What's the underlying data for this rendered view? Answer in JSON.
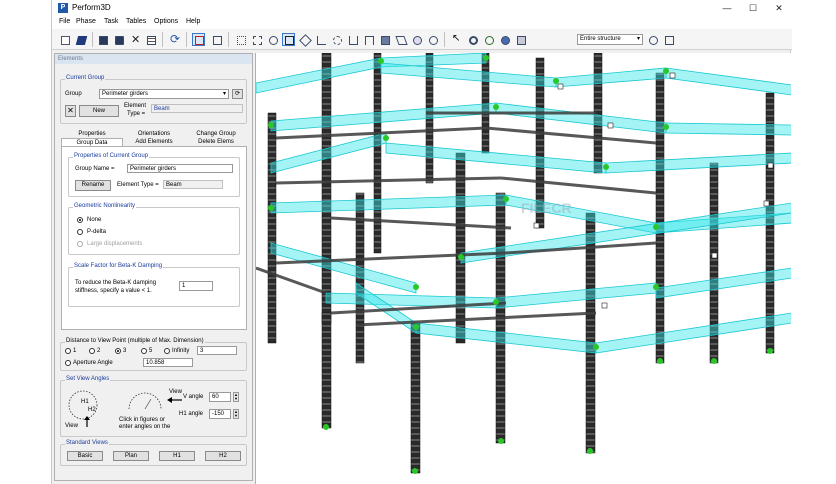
{
  "app": {
    "title": "Perform3D",
    "logo_letter": "P"
  },
  "window_controls": {
    "minimize": "—",
    "maximize": "☐",
    "close": "✕"
  },
  "menu": [
    "File",
    "Phase",
    "Task",
    "Tables",
    "Options",
    "Help"
  ],
  "toolbar": {
    "structure_select": "Entire structure",
    "icons": [
      "new-file-icon",
      "open-file-icon",
      "save-icon",
      "save-as-icon",
      "delete-icon",
      "table-icon",
      "refresh-icon",
      "elements-view-icon",
      "nodes-icon",
      "frame-icon",
      "zoom-box-icon",
      "rotate-icon",
      "pan-icon",
      "cube-icon",
      "axes-icon",
      "dimension-icon",
      "print-icon",
      "pencil-icon",
      "scale-icon",
      "search-zoom-icon",
      "zoom-out-icon",
      "zoom-in-icon",
      "undo-view-icon",
      "printer-icon",
      "settings-icon",
      "clock-icon",
      "compare-icon"
    ]
  },
  "panel": {
    "title": "Elements",
    "current_group": {
      "label": "Current Group",
      "group_label": "Group",
      "group_value": "Perimeter girders",
      "new_button": "New",
      "element_type_label_1": "Element",
      "element_type_label_2": "Type =",
      "element_type_value": "Beam"
    },
    "tabs_row1": [
      "Properties",
      "Orientations",
      "Change Group"
    ],
    "tabs_row2": [
      "Group Data",
      "Add Elements",
      "Delete Elems"
    ],
    "properties": {
      "label": "Properties of Current Group",
      "group_name_label": "Group Name =",
      "group_name_value": "Perimeter girders",
      "rename_button": "Rename",
      "element_type_label": "Element Type =",
      "element_type_value": "Beam"
    },
    "nonlinearity": {
      "label": "Geometric Nonlinearity",
      "options": [
        "None",
        "P-delta",
        "Large displacements"
      ]
    },
    "damping": {
      "label": "Scale Factor for Beta-K Damping",
      "text_1": "To reduce the Beta-K damping",
      "text_2": "stiffness, specify a value < 1.",
      "value": "1"
    },
    "distance": {
      "label": "Distance to View Point (multiple of Max. Dimension)",
      "options": [
        "1",
        "2",
        "3",
        "5",
        "Infinity"
      ],
      "value": "3",
      "aperture_label": "Aperture Angle",
      "aperture_value": "10.858"
    },
    "view_angles": {
      "label": "Set View Angles",
      "h1": "H1",
      "h2": "H2",
      "view": "View",
      "view_right": "View",
      "hint_1": "Click in figures or",
      "hint_2": "enter angles on the",
      "v_angle_label": "V angle",
      "v_angle_value": "60",
      "h1_angle_label": "H1 angle",
      "h1_angle_value": "-150"
    },
    "standard_views": {
      "label": "Standard Views",
      "buttons": [
        "Basic",
        "Plan",
        "H1",
        "H2"
      ]
    }
  },
  "viewport": {
    "watermark": "FILECR",
    "colors": {
      "girder": "#36e6ec",
      "column": "#3c3c3c",
      "node": "#28c828",
      "background": "#ffffff"
    }
  }
}
